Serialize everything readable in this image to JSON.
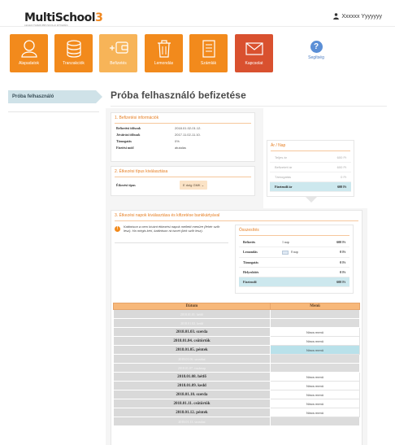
{
  "header": {
    "brand": "MultiSchool",
    "brand_num": "3",
    "tagline": "LEGEGYSZERŰBB ISKOLAI ÉTKEZÉS",
    "user_name": "Xxxxxx Yyyyyyy"
  },
  "nav": [
    {
      "label": "Alapadatok",
      "icon": "user-icon"
    },
    {
      "label": "Tranzakciók",
      "icon": "coins-icon"
    },
    {
      "label": "Befizetés",
      "icon": "wallet-plus-icon"
    },
    {
      "label": "Lemondás",
      "icon": "trash-icon"
    },
    {
      "label": "Számlák",
      "icon": "invoice-icon"
    },
    {
      "label": "Kapcsolat",
      "icon": "envelope-icon"
    }
  ],
  "help": {
    "label": "Segítség",
    "icon": "question-icon"
  },
  "sidebar": {
    "active_item": "Próba felhasználó"
  },
  "page_title": "Próba felhasználó befizetése",
  "section1": {
    "title": "1. Befizetési információk",
    "rows": [
      {
        "k": "Befizetési időszak",
        "v": "2018.01.02-01.12."
      },
      {
        "k": "Jóváírási időszak",
        "v": "2017.11.02-11.10."
      },
      {
        "k": "Támogatás",
        "v": "0%"
      },
      {
        "k": "Fizetési mód",
        "v": "átutalás"
      }
    ]
  },
  "section2": {
    "title": "2. Étkezési típus kiválasztása",
    "label": "Étkezési típus",
    "selected": "E dolg GMK"
  },
  "price": {
    "title": "Ár / Nap",
    "rows": [
      {
        "k": "Teljes ár",
        "v": "600 Ft"
      },
      {
        "k": "Befizetett ár",
        "v": "600 Ft"
      },
      {
        "k": "Támogatás",
        "v": "0 Ft"
      }
    ],
    "total": {
      "k": "Fizetendő ár",
      "v": "600 Ft"
    }
  },
  "section3": {
    "title": "3. Étkezési napok kiválasztása és kifizetése bankkártyával",
    "info": "Kattintson a nem kívánt étkezési napok melletti menüre (fehér szőr lesz). Ha mégis kéri, kattintson rá ismét (kék szőr lesz).",
    "summary": {
      "title": "Összesítés",
      "rows": [
        {
          "k": "Befizetés",
          "m": "1 nap",
          "v": "600 Ft"
        },
        {
          "k": "Lemondás",
          "m": "0 nap",
          "v": "0 Ft"
        },
        {
          "k": "Támogatás",
          "m": "",
          "v": "0 Ft"
        },
        {
          "k": "Helyesbítés",
          "m": "",
          "v": "0 Ft"
        }
      ],
      "total": {
        "k": "Fizetendő",
        "v": "600 Ft"
      }
    }
  },
  "table": {
    "headers": [
      "Dátum",
      "Menü"
    ],
    "rows": [
      {
        "date": "2018.01.01. hétfő",
        "menu": "",
        "state": "muted"
      },
      {
        "date": "2018.01.02. kedd",
        "menu": "",
        "state": "muted"
      },
      {
        "date": "2018.01.03. szerda",
        "menu": "Nincs menü",
        "state": "normal"
      },
      {
        "date": "2018.01.04. csütörtök",
        "menu": "Nincs menü",
        "state": "normal"
      },
      {
        "date": "2018.01.05. péntek",
        "menu": "Nincs menü",
        "state": "selected"
      },
      {
        "date": "2018.01.06. szombat",
        "menu": "",
        "state": "muted"
      },
      {
        "date": "2018.01.07. vasárnap",
        "menu": "",
        "state": "muted"
      },
      {
        "date": "2018.01.08. hétfő",
        "menu": "Nincs menü",
        "state": "normal"
      },
      {
        "date": "2018.01.09. kedd",
        "menu": "Nincs menü",
        "state": "normal"
      },
      {
        "date": "2018.01.10. szerda",
        "menu": "Nincs menü",
        "state": "normal"
      },
      {
        "date": "2018.01.11. csütörtök",
        "menu": "Nincs menü",
        "state": "normal"
      },
      {
        "date": "2018.01.12. péntek",
        "menu": "Nincs menü",
        "state": "normal"
      },
      {
        "date": "2018.01.13. szombat",
        "menu": "",
        "state": "muted"
      }
    ]
  },
  "colors": {
    "accent": "#f28a1c",
    "accent_light": "#f7b458",
    "contact": "#d9512f",
    "selected": "#b9e1ea"
  }
}
